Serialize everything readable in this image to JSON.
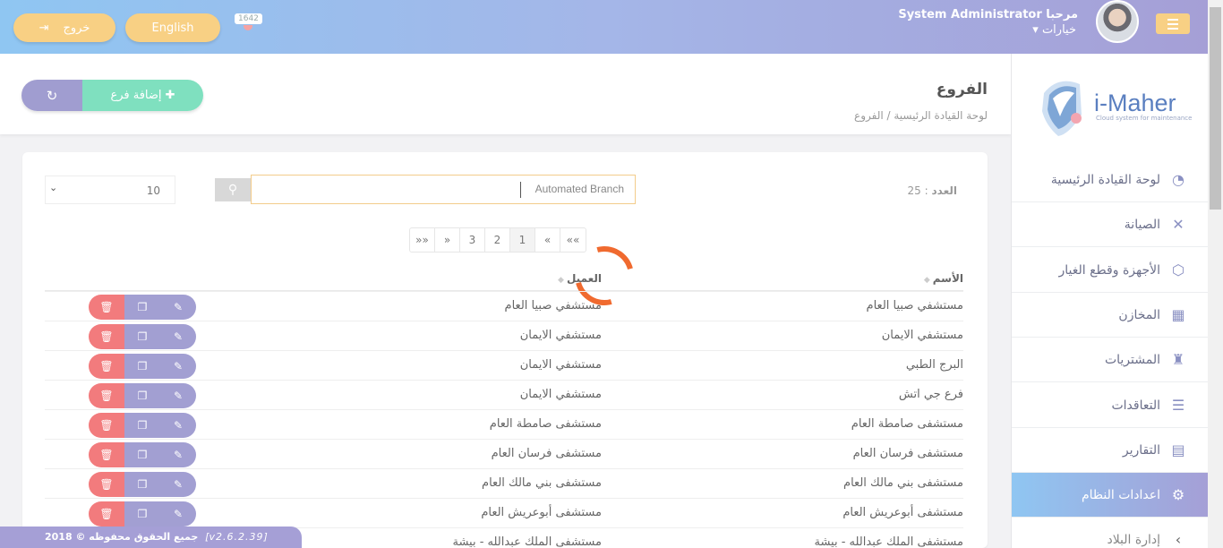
{
  "topbar": {
    "logout_label": "خروج",
    "language_label": "English",
    "notification_count": "1642",
    "greeting": "مرحبا System Administrator",
    "options_label": "خيارات"
  },
  "sidebar": {
    "logo_text": "i-Maher",
    "logo_subtitle": "Cloud system for maintenance",
    "items": [
      {
        "label": "لوحة القيادة الرئيسية",
        "icon": "dashboard-icon"
      },
      {
        "label": "الصيانة",
        "icon": "tools-icon"
      },
      {
        "label": "الأجهزة وقطع الغيار",
        "icon": "box-icon"
      },
      {
        "label": "المخازن",
        "icon": "warehouse-icon"
      },
      {
        "label": "المشتريات",
        "icon": "purchases-icon"
      },
      {
        "label": "التعاقدات",
        "icon": "contracts-icon"
      },
      {
        "label": "التقارير",
        "icon": "reports-icon"
      },
      {
        "label": "اعدادات النظام",
        "icon": "gear-icon"
      },
      {
        "label": "إدارة البلاد",
        "icon": "chevron-left-icon"
      }
    ],
    "active_index": 7
  },
  "header": {
    "title": "الفروع",
    "breadcrumb": "لوحة القيادة الرئيسية /  الفروع",
    "add_button": "إضافة فرع"
  },
  "toolbar": {
    "count_label": "العدد",
    "count_value": ": 25",
    "search_value": "Automated Branch",
    "per_page": "10"
  },
  "pagination": [
    "»»",
    "»",
    "3",
    "2",
    "1",
    "«",
    "««"
  ],
  "table": {
    "columns": [
      "الأسم",
      "العميل"
    ],
    "rows": [
      [
        "مستشفي صبيا العام",
        "مستشفي صبيا العام"
      ],
      [
        "مستشفي الايمان",
        "مستشفي الايمان"
      ],
      [
        "البرج الطبي",
        "مستشفي الايمان"
      ],
      [
        "فرع جي اتش",
        "مستشفي الايمان"
      ],
      [
        "مستشفى صامطة العام",
        "مستشفى صامطة العام"
      ],
      [
        "مستشفى فرسان العام",
        "مستشفى فرسان العام"
      ],
      [
        "مستشفى بني مالك العام",
        "مستشفى بني مالك العام"
      ],
      [
        "مستشفى أبوعريش العام",
        "مستشفى أبوعريش العام"
      ],
      [
        "مستشفى الملك عبدالله - بيشة",
        "مستشفى الملك عبدالله - بيشة"
      ]
    ]
  },
  "footer": {
    "copyright": "جميع الحقوق محفوظه © 2018",
    "version": "[v2.6.2.39]"
  }
}
